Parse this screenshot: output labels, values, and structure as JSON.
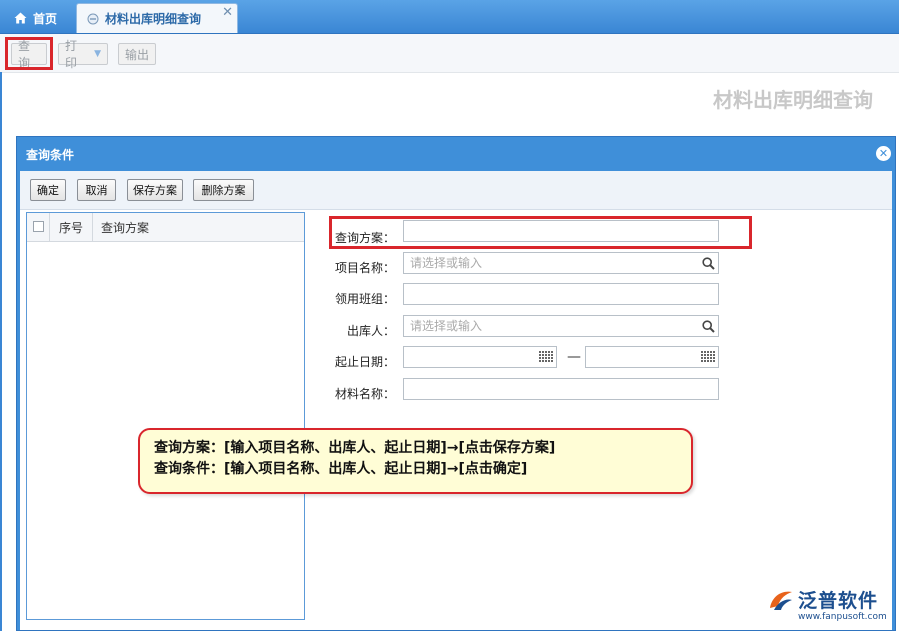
{
  "tabs": {
    "home_label": "首页",
    "active_label": "材料出库明细查询",
    "close_glyph": "✕"
  },
  "toolbar": {
    "query_label": "查询",
    "print_label": "打印",
    "export_label": "输出"
  },
  "page_title": "材料出库明细查询",
  "dialog": {
    "title": "查询条件",
    "close_glyph": "✕",
    "buttons": {
      "confirm": "确定",
      "cancel": "取消",
      "save_plan": "保存方案",
      "delete_plan": "删除方案"
    },
    "list": {
      "col_no": "序号",
      "col_name": "查询方案"
    },
    "form": {
      "plan_label": "查询方案：",
      "plan_value": "",
      "project_label": "项目名称：",
      "project_placeholder": "请选择或输入",
      "team_label": "领用班组：",
      "team_value": "",
      "issuer_label": "出库人：",
      "issuer_placeholder": "请选择或输入",
      "date_label": "起止日期：",
      "date_start": "",
      "date_end": "",
      "date_sep": "—",
      "material_label": "材料名称：",
      "material_value": ""
    }
  },
  "callout": {
    "line1": "查询方案：[输入项目名称、出库人、起止日期]→[点击保存方案]",
    "line2": "查询条件：[输入项目名称、出库人、起止日期]→[点击确定]"
  },
  "logo": {
    "name": "泛普软件",
    "url": "www.fanpusoft.com"
  },
  "colors": {
    "accent": "#3f8fd9",
    "highlight": "#d9262c",
    "callout_bg": "#fffdd6"
  },
  "icons": [
    "home-icon",
    "tab-page-icon",
    "close-icon",
    "search-icon",
    "calendar-icon",
    "logo-icon"
  ]
}
